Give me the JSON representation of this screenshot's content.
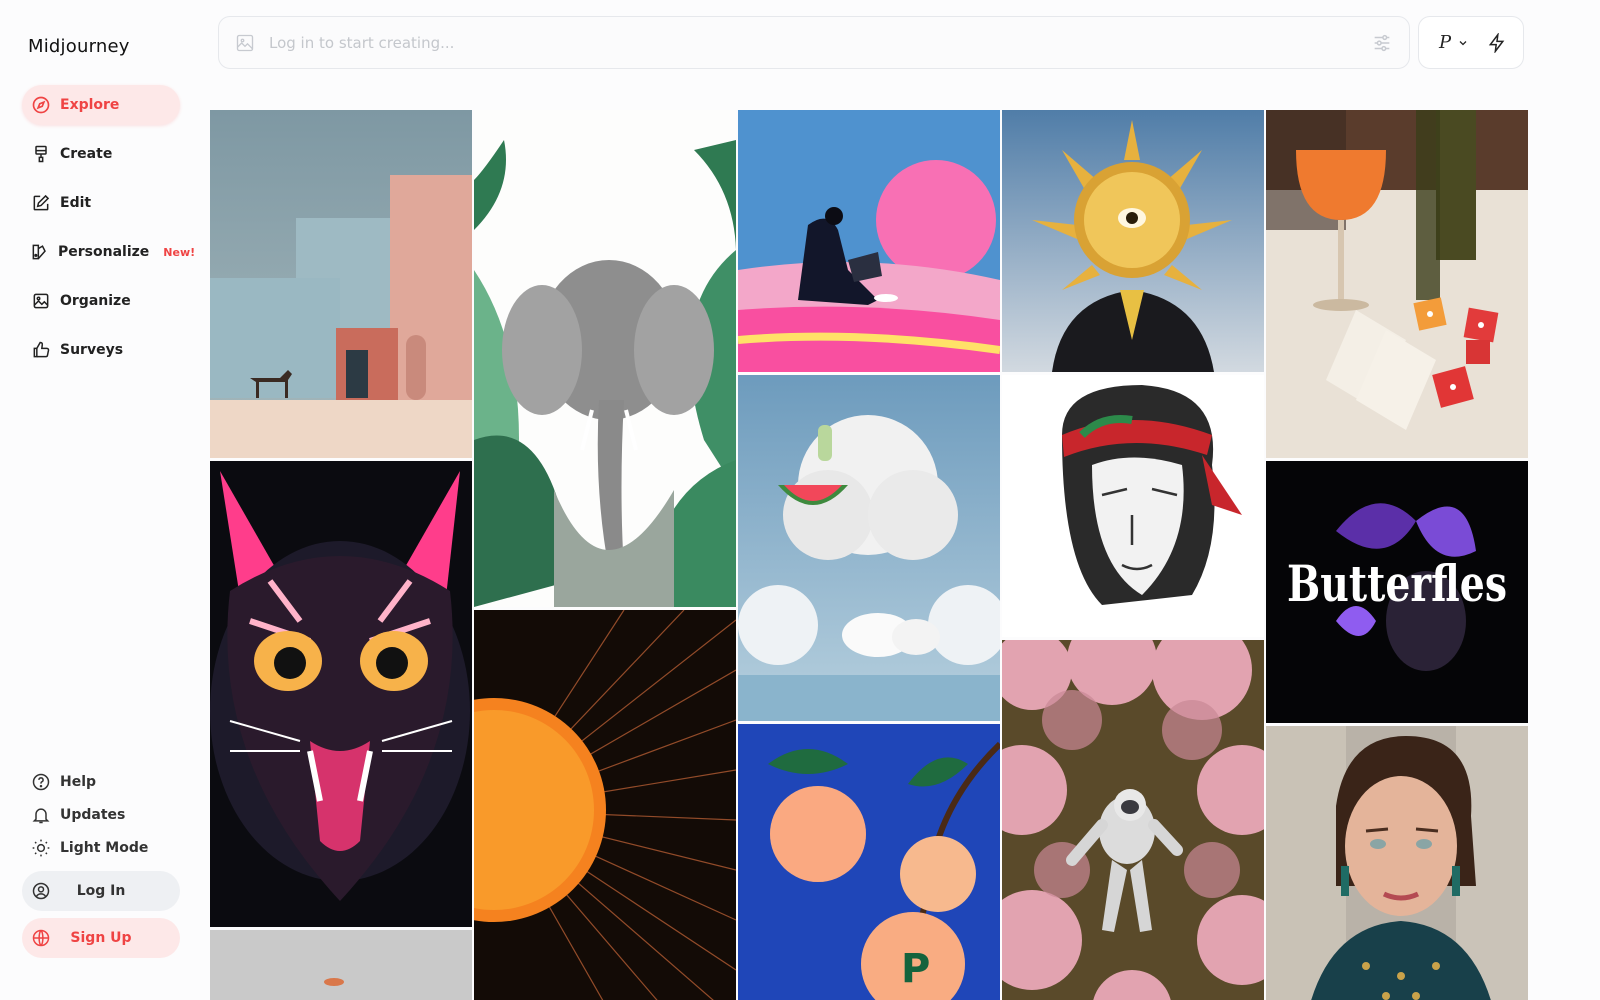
{
  "app": {
    "title": "Midjourney"
  },
  "nav": [
    {
      "label": "Explore",
      "icon": "compass-icon",
      "active": true
    },
    {
      "label": "Create",
      "icon": "paintbrush-icon"
    },
    {
      "label": "Edit",
      "icon": "pencil-square-icon"
    },
    {
      "label": "Personalize",
      "icon": "personalize-icon",
      "badge": "New!"
    },
    {
      "label": "Organize",
      "icon": "image-icon"
    },
    {
      "label": "Surveys",
      "icon": "thumbs-up-icon"
    }
  ],
  "bottom": {
    "help": "Help",
    "updates": "Updates",
    "light_mode": "Light Mode",
    "login": "Log In",
    "signup": "Sign Up"
  },
  "prompt": {
    "placeholder": "Log in to start creating..."
  },
  "mode": {
    "label": "P"
  },
  "colors": {
    "accent": "#ef4444",
    "accent_bg": "#fde8e8"
  },
  "gallery": [
    "pink-building-horse-image",
    "elephant-jungle-image",
    "laptop-man-pink-sun-image",
    "golden-sun-head-image",
    "wine-dice-cards-image",
    "neon-cat-image",
    "orange-sun-circuit-image",
    "cloud-watermelon-crocs-image",
    "bandana-portrait-sketch-image",
    "butterflies-poster-image",
    "peaches-image",
    "astronaut-flowers-image",
    "woman-portrait-image"
  ],
  "butterflies_text": "Butterfles"
}
